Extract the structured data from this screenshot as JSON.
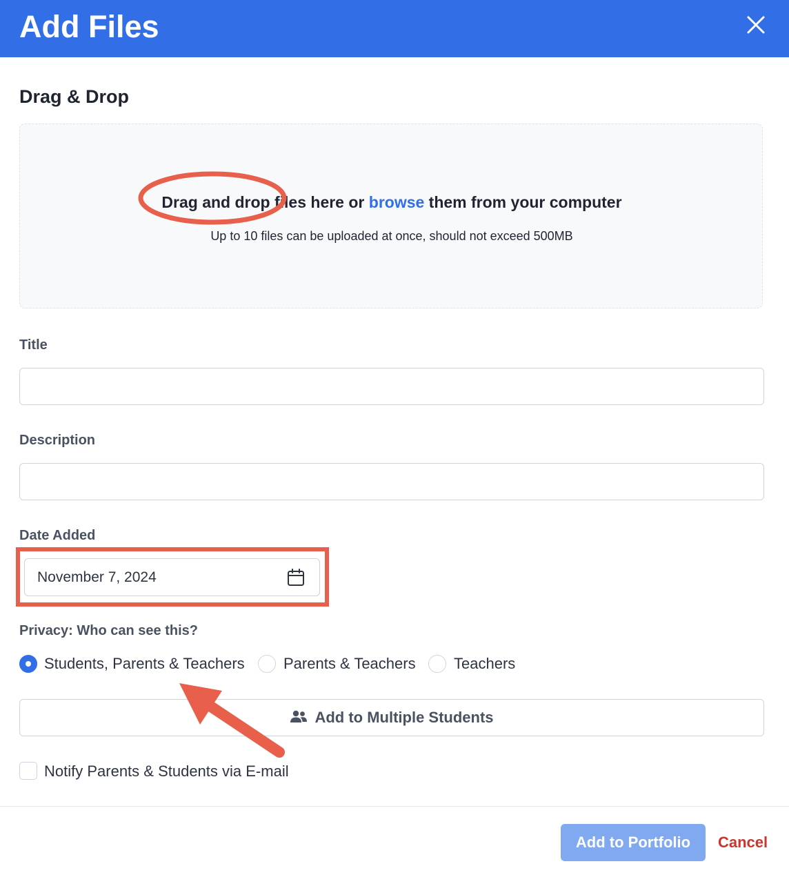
{
  "dialog": {
    "title": "Add Files",
    "close_icon": "close-icon"
  },
  "dropzone": {
    "heading": "Drag & Drop",
    "text_before_link": "Drag and drop files here or ",
    "link_text": "browse",
    "text_after_link": " them from your computer",
    "hint": "Up to 10 files can be uploaded at once, should not exceed 500MB"
  },
  "form": {
    "title_label": "Title",
    "title_value": "",
    "description_label": "Description",
    "description_value": "",
    "date_label": "Date Added",
    "date_value": "November 7, 2024",
    "date_icon": "calendar-icon",
    "privacy_label": "Privacy: Who can see this?",
    "privacy_options": [
      {
        "label": "Students, Parents & Teachers",
        "selected": true
      },
      {
        "label": "Parents & Teachers",
        "selected": false
      },
      {
        "label": "Teachers",
        "selected": false
      }
    ],
    "multi_students_label": "Add to Multiple Students",
    "multi_students_icon": "users-icon",
    "notify_label": "Notify Parents & Students via E-mail",
    "notify_checked": false
  },
  "footer": {
    "submit_label": "Add to Portfolio",
    "cancel_label": "Cancel"
  },
  "colors": {
    "header_bg": "#326fe6",
    "link": "#326fe6",
    "primary_button": "#80a9f0",
    "cancel_text": "#c8372d",
    "annotation": "#e8604c"
  }
}
